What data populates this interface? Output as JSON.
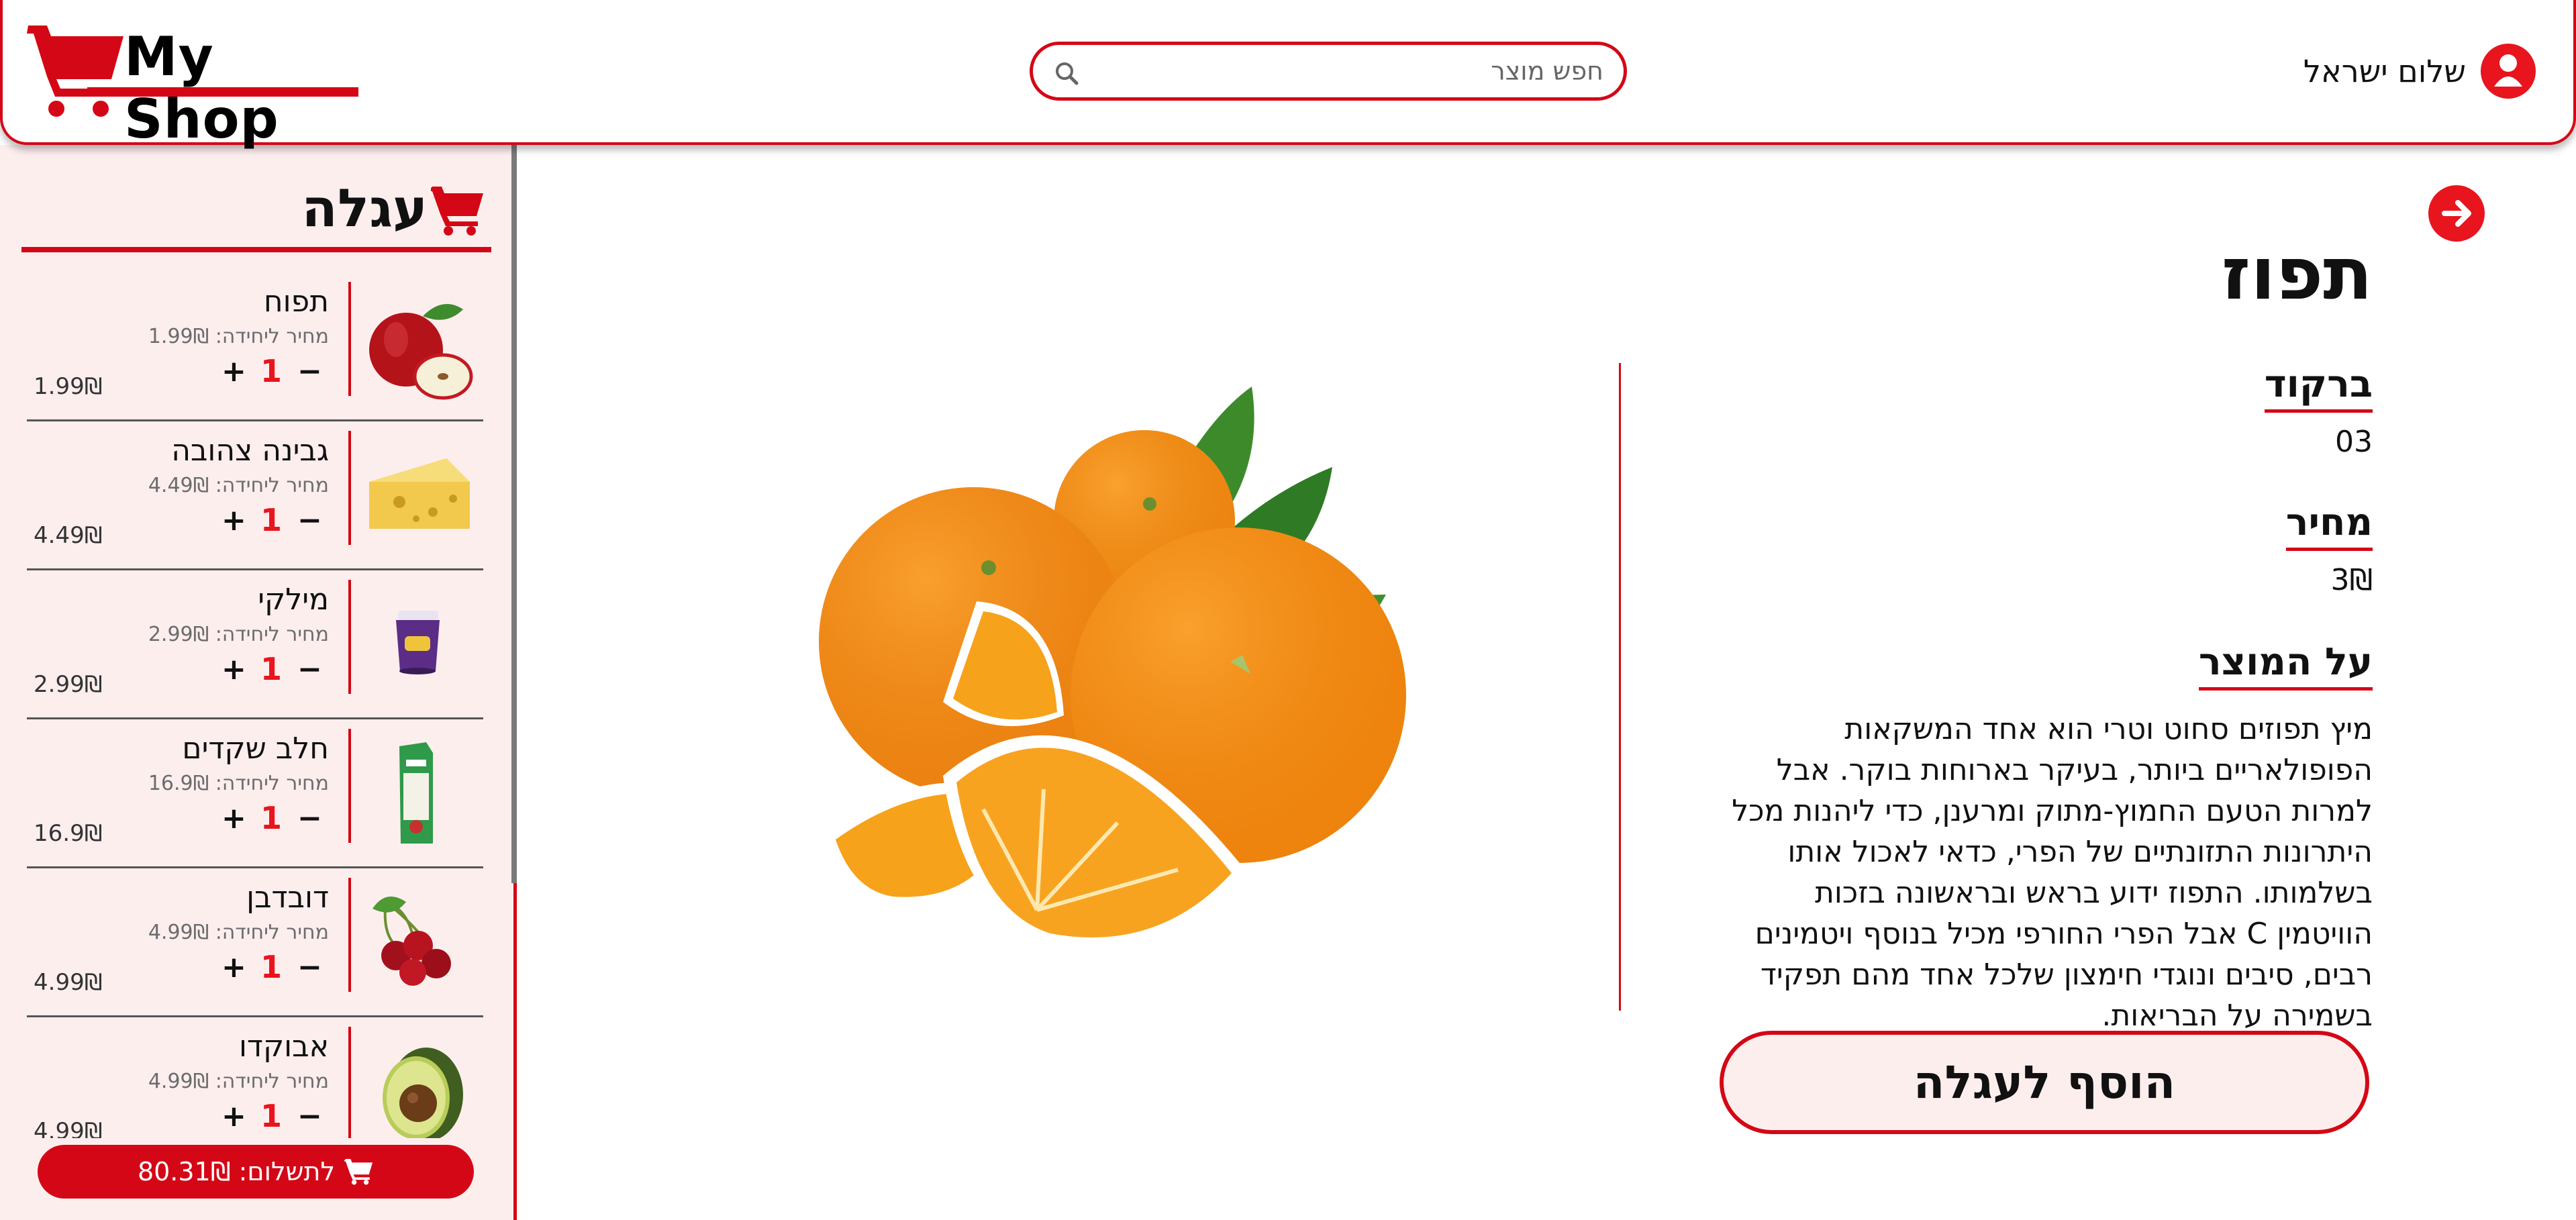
{
  "header": {
    "logo_text": "My Shop",
    "search_placeholder": "חפש מוצר",
    "user_name": "שלום ישראל"
  },
  "cart": {
    "title": "עגלה",
    "items": [
      {
        "name": "תפוח",
        "unit_price": "מחיר ליחידה: 1.99₪",
        "qty": "1",
        "total": "1.99₪",
        "icon": "apple-icon"
      },
      {
        "name": "גבינה צהובה",
        "unit_price": "מחיר ליחידה: 4.49₪",
        "qty": "1",
        "total": "4.49₪",
        "icon": "cheese-icon"
      },
      {
        "name": "מילקי",
        "unit_price": "מחיר ליחידה: 2.99₪",
        "qty": "1",
        "total": "2.99₪",
        "icon": "pudding-cup-icon"
      },
      {
        "name": "חלב שקדים",
        "unit_price": "מחיר ליחידה: 16.9₪",
        "qty": "1",
        "total": "16.9₪",
        "icon": "milk-carton-icon"
      },
      {
        "name": "דובדבן",
        "unit_price": "מחיר ליחידה: 4.99₪",
        "qty": "1",
        "total": "4.99₪",
        "icon": "cherry-icon"
      },
      {
        "name": "אבוקדו",
        "unit_price": "מחיר ליחידה: 4.99₪",
        "qty": "1",
        "total": "4.99₪",
        "icon": "avocado-icon"
      }
    ],
    "plus": "+",
    "minus": "−",
    "checkout_label": "לתשלום: 80.31₪"
  },
  "product": {
    "title": "תפוז",
    "barcode_label": "ברקוד",
    "barcode_value": "03",
    "price_label": "מחיר",
    "price_value": "3₪",
    "about_label": "על המוצר",
    "description": "מיץ תפוזים סחוט וטרי הוא אחד המשקאות הפופולאריים ביותר, בעיקר בארוחות בוקר. אבל למרות הטעם החמוץ-מתוק ומרענן, כדי ליהנות מכל היתרונות התזונתיים של הפרי, כדאי לאכול אותו בשלמותו. התפוז ידוע בראש ובראשונה בזכות הוויטמין C אבל הפרי החורפי מכיל בנוסף ויטמינים רבים, סיבים ונוגדי חימצון שלכל אחד מהם תפקיד בשמירה על הבריאות.",
    "add_to_cart_label": "הוסף לעגלה",
    "image_icon": "orange-fruit-image"
  },
  "colors": {
    "accent": "#d40716",
    "sidebar_bg": "#fdeeee"
  }
}
